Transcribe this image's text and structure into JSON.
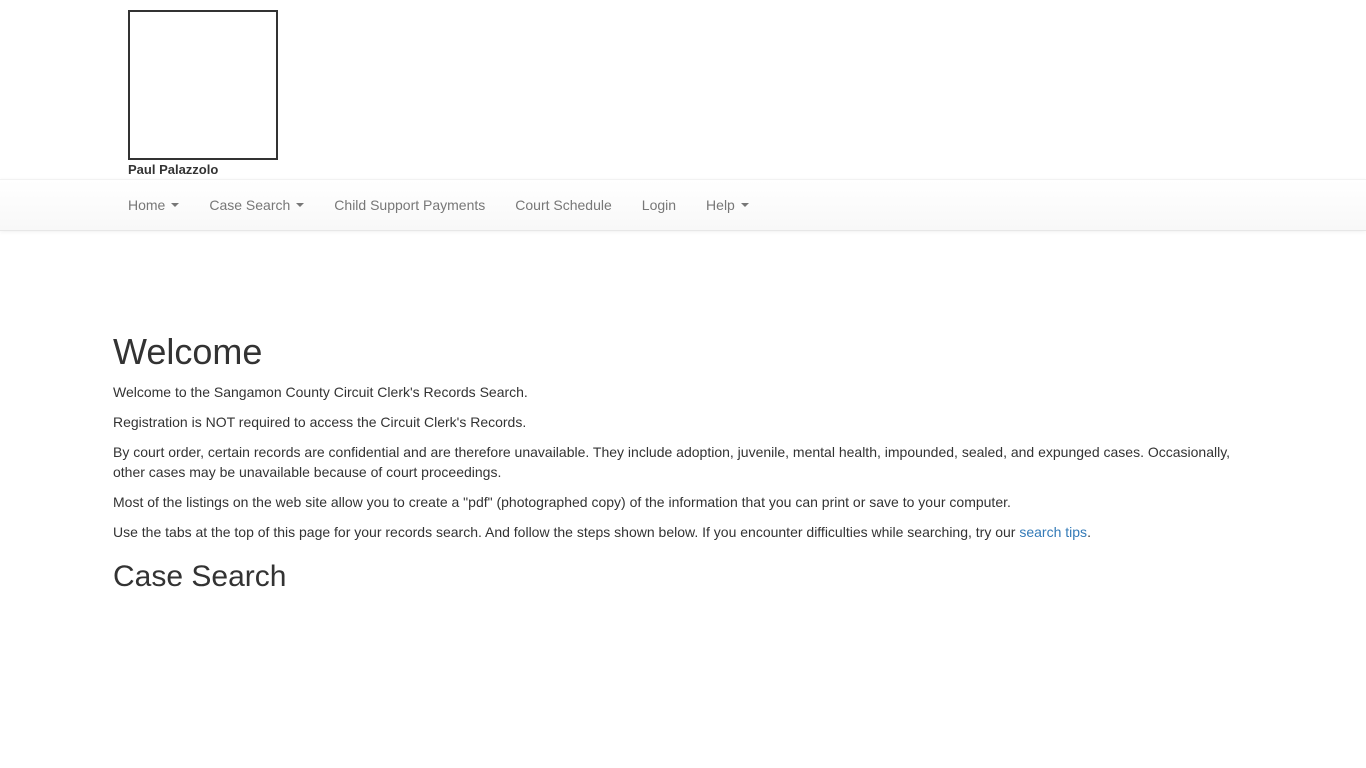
{
  "header": {
    "clerk_name": "Paul Palazzolo"
  },
  "nav": {
    "items": [
      {
        "label": "Home",
        "dropdown": true
      },
      {
        "label": "Case Search",
        "dropdown": true
      },
      {
        "label": "Child Support Payments",
        "dropdown": false
      },
      {
        "label": "Court Schedule",
        "dropdown": false
      },
      {
        "label": "Login",
        "dropdown": false
      },
      {
        "label": "Help",
        "dropdown": true
      }
    ]
  },
  "main": {
    "heading": "Welcome",
    "paragraphs": [
      "Welcome to the Sangamon County Circuit Clerk's Records Search.",
      "Registration is NOT required to access the Circuit Clerk's Records.",
      "By court order, certain records are confidential and are therefore unavailable. They include adoption, juvenile, mental health, impounded, sealed, and expunged cases. Occasionally, other cases may be unavailable because of court proceedings.",
      "Most of the listings on the web site allow you to create a \"pdf\" (photographed copy) of the information that you can print or save to your computer."
    ],
    "tabs_paragraph": {
      "text": "Use the tabs at the top of this page for your records search. And follow the steps shown below. If you encounter difficulties while searching, try our ",
      "link_label": "search tips",
      "suffix": "."
    },
    "subheading": "Case Search"
  },
  "colors": {
    "link": "#337ab7",
    "nav_text": "#777777",
    "body_text": "#333333"
  }
}
